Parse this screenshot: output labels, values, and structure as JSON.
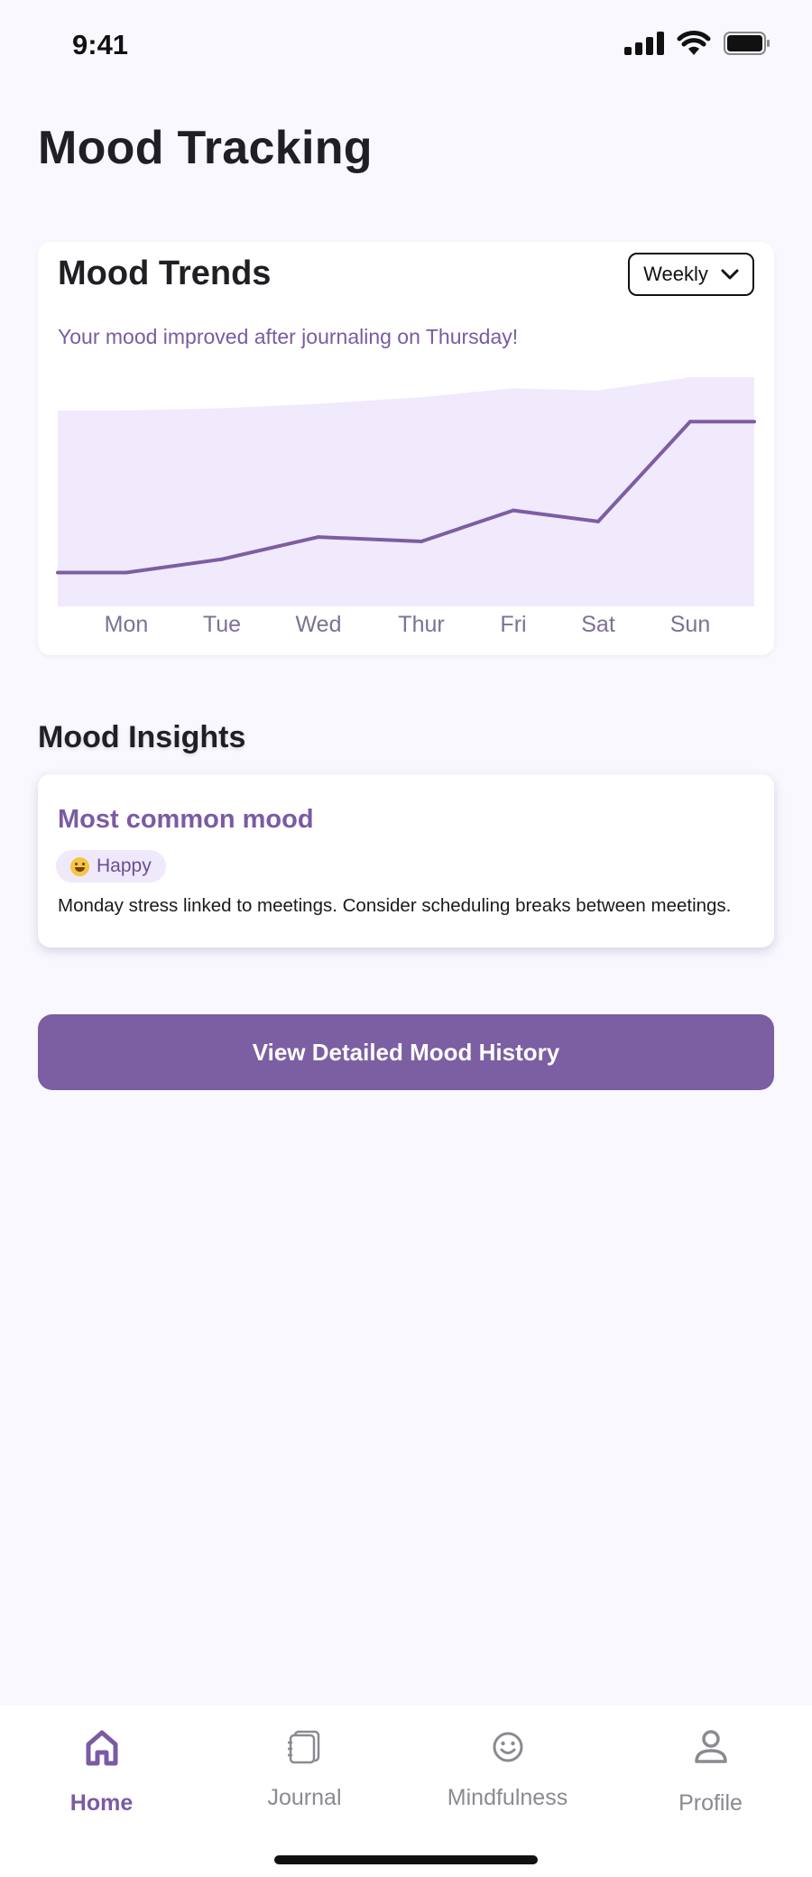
{
  "status_bar": {
    "time": "9:41"
  },
  "page": {
    "title": "Mood Tracking"
  },
  "trends": {
    "title": "Mood Trends",
    "period_select": "Weekly",
    "note": "Your mood improved after journaling on Thursday!"
  },
  "chart_data": {
    "type": "line",
    "categories": [
      "Mon",
      "Tue",
      "Wed",
      "Thur",
      "Fri",
      "Sat",
      "Sun"
    ],
    "series": [
      {
        "values": [
          12,
          18,
          28,
          26,
          40,
          35,
          80
        ]
      },
      {
        "values": [
          85,
          86,
          88,
          91,
          95,
          94,
          100
        ]
      }
    ],
    "colors": {
      "line": "#7c5ea3",
      "area": "#f1e9fc"
    }
  },
  "insights": {
    "section_title": "Mood Insights",
    "card_title": "Most common mood",
    "mood_chip": "Happy",
    "text": "Monday stress linked to meetings. Consider scheduling breaks between meetings."
  },
  "cta": {
    "label": "View Detailed Mood History"
  },
  "nav": {
    "items": [
      {
        "label": "Home",
        "icon": "home-icon",
        "active": true
      },
      {
        "label": "Journal",
        "icon": "journal-icon",
        "active": false
      },
      {
        "label": "Mindfulness",
        "icon": "smile-icon",
        "active": false
      },
      {
        "label": "Profile",
        "icon": "profile-icon",
        "active": false
      }
    ]
  },
  "colors": {
    "accent": "#7c5ea3",
    "background": "#f9f8fe",
    "chip_bg": "#f0e8fb"
  }
}
